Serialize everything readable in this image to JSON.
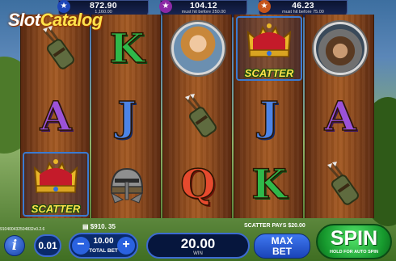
{
  "logo": {
    "part1": "Slot",
    "part2": "Catalog"
  },
  "jackpots": [
    {
      "value": "872.90",
      "sub": "1,160.00",
      "label": "CONS"
    },
    {
      "value": "104.12",
      "sub": "must hit before 250.00"
    },
    {
      "value": "46.23",
      "sub": "must hit before 75.00"
    }
  ],
  "reels": [
    [
      "crossbow-bag",
      "A",
      "scatter-crown"
    ],
    [
      "K",
      "J",
      "helmet"
    ],
    [
      "lady-portrait",
      "crossbow-bag",
      "Q"
    ],
    [
      "scatter-crown",
      "J",
      "K"
    ],
    [
      "warrior-portrait",
      "A",
      "crossbow-bag"
    ]
  ],
  "symbols": {
    "A": "A",
    "K": "K",
    "J": "J",
    "Q": "Q",
    "scatter": "SCATTER"
  },
  "status": {
    "balance": "$910. 35",
    "scatter_pays": "SCATTER PAYS $20.00",
    "version": "910400432504832v0.2.6"
  },
  "controls": {
    "info": "i",
    "coin_value": "0.01",
    "minus": "−",
    "plus": "+",
    "total_bet_value": "10.00",
    "total_bet_label": "TOTAL BET",
    "win_value": "20.00",
    "win_label": "WIN",
    "max_bet_line1": "MAX",
    "max_bet_line2": "BET",
    "spin_label": "SPIN",
    "spin_hint": "HOLD FOR AUTO SPIN"
  },
  "colors": {
    "spin": "#1fa837",
    "buttons": "#2a62e0",
    "scatter_text": "#ffe14b"
  }
}
